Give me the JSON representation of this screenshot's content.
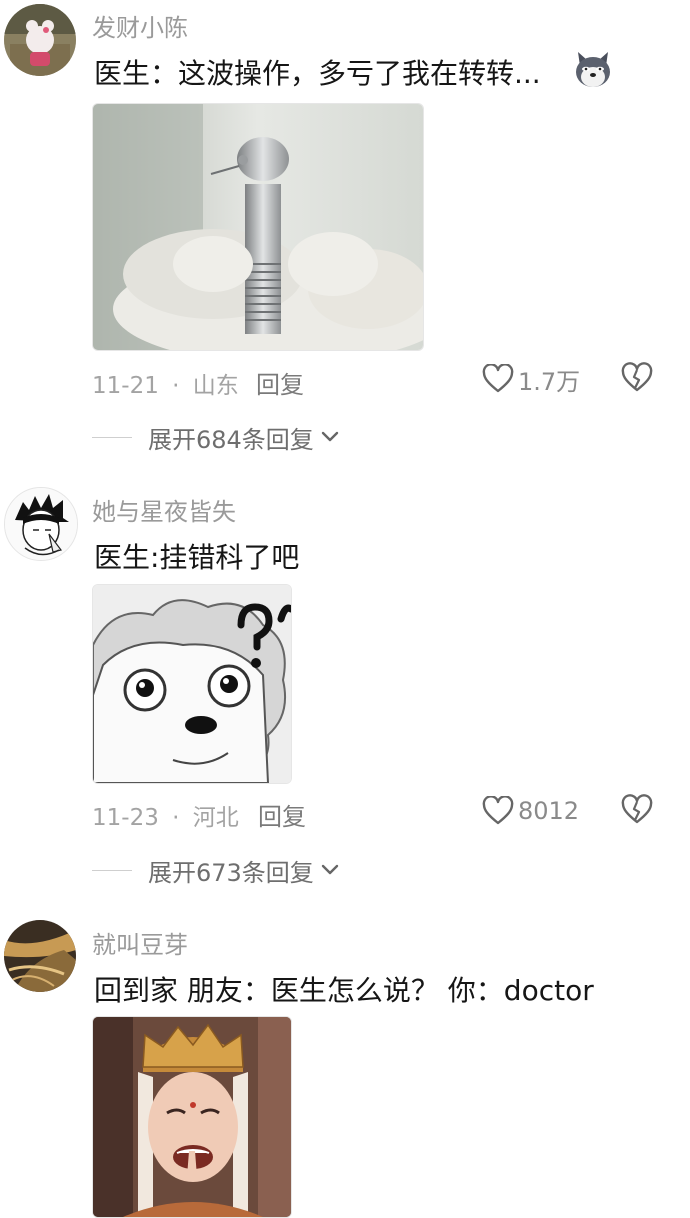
{
  "comments": [
    {
      "username": "发财小陈",
      "text": "医生：这波操作，多亏了我在转转...",
      "emoji_icon": "husky-dog-emoji-icon",
      "image_subject": "dental-drill-handpiece",
      "date": "11-21",
      "separator": "·",
      "location": "山东",
      "reply_label": "回复",
      "like_count": "1.7万",
      "expand_label": "展开684条回复"
    },
    {
      "username": "她与星夜皆失",
      "text": "医生:挂错科了吧",
      "image_subject": "confused-sheep-cartoon",
      "date": "11-23",
      "separator": "·",
      "location": "河北",
      "reply_label": "回复",
      "like_count": "8012",
      "expand_label": "展开673条回复"
    },
    {
      "username": "就叫豆芽",
      "text": "回到家 朋友：医生怎么说？ 你：doctor",
      "image_subject": "tang-monk-laughing"
    }
  ],
  "icons": {
    "like": "heart-outline-icon",
    "dislike": "broken-heart-icon",
    "expand": "chevron-down-icon"
  },
  "colors": {
    "username": "#9a9a9a",
    "text": "#161616",
    "meta": "#a3a3a3",
    "icon": "#666666"
  }
}
